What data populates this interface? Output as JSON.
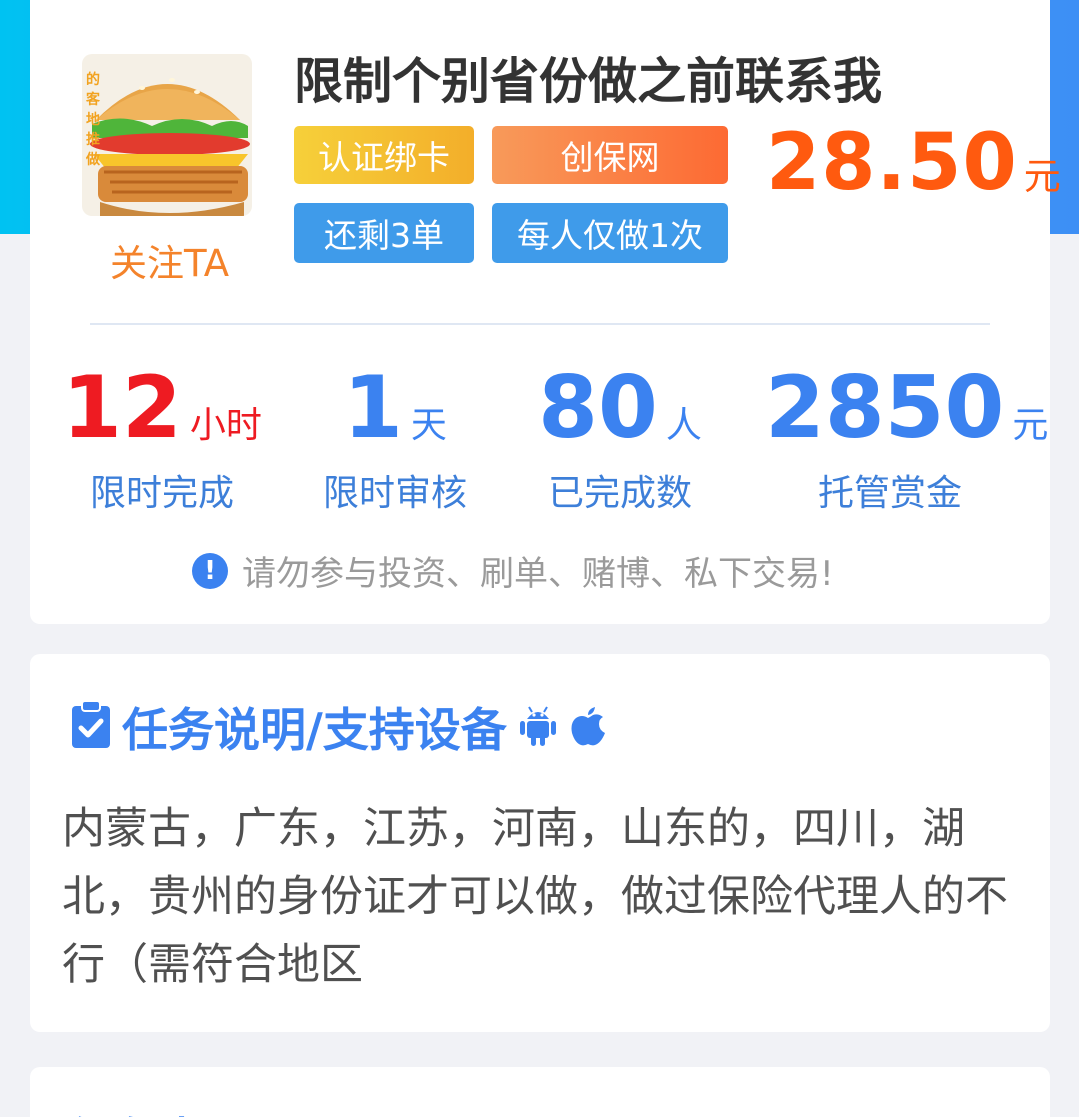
{
  "task": {
    "follow_label": "关注TA",
    "title": "限制个别省份做之前联系我",
    "tags": {
      "verify": "认证绑卡",
      "platform": "创保网",
      "remaining": "还剩3单",
      "limit": "每人仅做1次"
    },
    "price": {
      "amount": "28.50",
      "unit": "元"
    },
    "stats": [
      {
        "value": "12",
        "unit": "小时",
        "label": "限时完成"
      },
      {
        "value": "1",
        "unit": "天",
        "label": "限时审核"
      },
      {
        "value": "80",
        "unit": "人",
        "label": "已完成数"
      },
      {
        "value": "2850",
        "unit": "元",
        "label": "托管赏金"
      }
    ],
    "warning": "请勿参与投资、刷单、赌博、私下交易!"
  },
  "description": {
    "title": "任务说明/支持设备",
    "text": "内蒙古，广东，江苏，河南，山东的，四川，湖北，贵州的身份证才可以做，做过保险代理人的不行（需符合地区",
    "icons": [
      "clipboard-check-icon",
      "android-icon",
      "apple-icon"
    ]
  },
  "next_section": {
    "title": "任务步骤"
  },
  "colors": {
    "header_gradient_start": "#00c2f2",
    "header_gradient_end": "#3d8ff5",
    "accent_blue": "#3b82f0",
    "price_orange": "#ff5a0f",
    "time_red": "#ee1b22"
  }
}
